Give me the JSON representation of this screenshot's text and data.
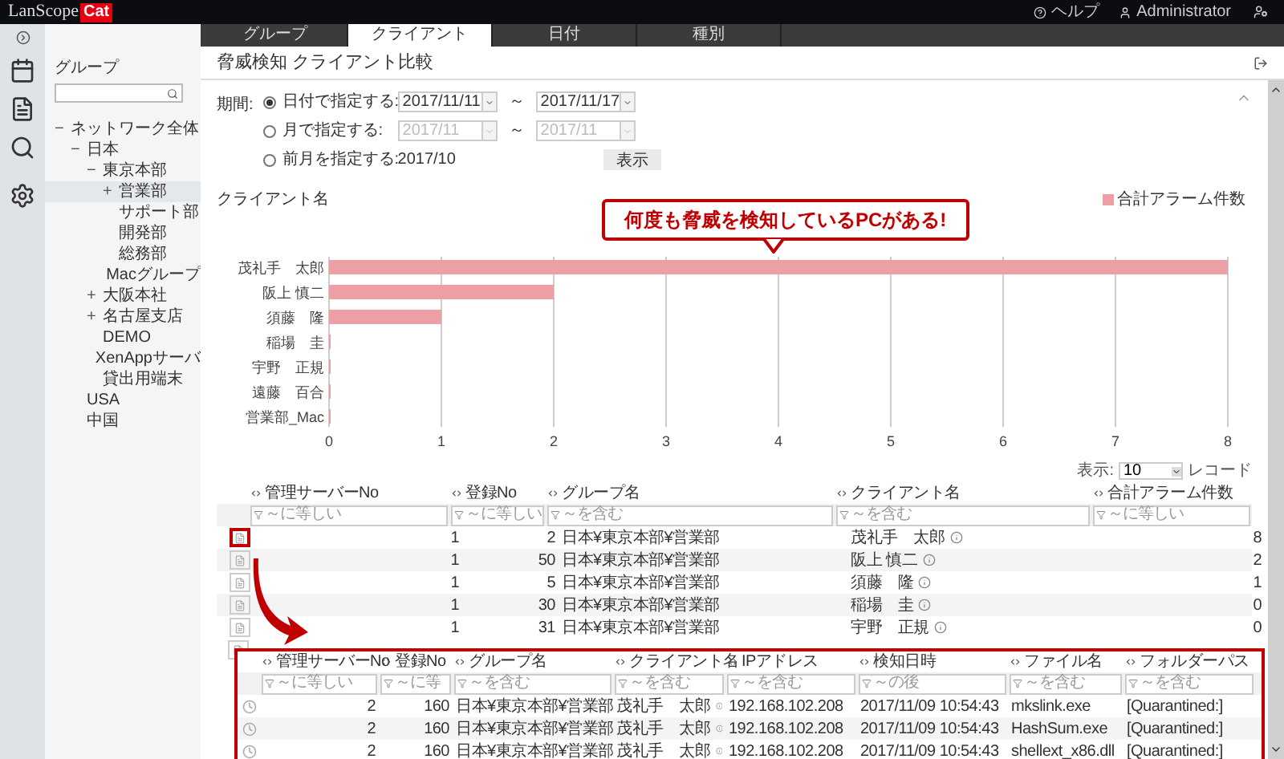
{
  "app": {
    "logo_text": "LanScope",
    "logo_badge": "Cat",
    "help": "ヘルプ",
    "user": "Administrator"
  },
  "tabs": [
    {
      "label": "グループ",
      "selected": false
    },
    {
      "label": "クライアント",
      "selected": true
    },
    {
      "label": "日付",
      "selected": false
    },
    {
      "label": "種別",
      "selected": false
    }
  ],
  "sidebar": {
    "title": "グループ",
    "tree": [
      {
        "label": "ネットワーク全体",
        "toggle": "−",
        "selected": false,
        "children": [
          {
            "label": "日本",
            "toggle": "−",
            "selected": false,
            "children": [
              {
                "label": "東京本部",
                "toggle": "−",
                "selected": false,
                "children": [
                  {
                    "label": "営業部",
                    "toggle": "+",
                    "selected": true
                  },
                  {
                    "label": "サポート部",
                    "selected": false
                  },
                  {
                    "label": "開発部",
                    "selected": false
                  },
                  {
                    "label": "総務部",
                    "selected": false
                  },
                  {
                    "label": "Macグループ",
                    "selected": false
                  }
                ]
              },
              {
                "label": "大阪本社",
                "toggle": "+",
                "selected": false
              },
              {
                "label": "名古屋支店",
                "toggle": "+",
                "selected": false
              },
              {
                "label": "DEMO",
                "selected": false
              },
              {
                "label": "XenAppサーバ",
                "selected": false
              },
              {
                "label": "貸出用端末",
                "selected": false
              }
            ]
          },
          {
            "label": "USA",
            "selected": false
          },
          {
            "label": "中国",
            "selected": false
          }
        ]
      }
    ]
  },
  "page_title": "脅威検知 クライアント比較",
  "period": {
    "label": "期間:",
    "options": [
      {
        "label": "日付で指定する:",
        "selected": true,
        "kind": "range",
        "from": "2017/11/11",
        "to": "2017/11/17",
        "sep": "～",
        "disabled": false
      },
      {
        "label": "月で指定する:",
        "selected": false,
        "kind": "range",
        "from": "2017/11",
        "to": "2017/11",
        "sep": "～",
        "disabled": true
      },
      {
        "label": "前月を指定する:",
        "selected": false,
        "kind": "text",
        "value": "2017/10"
      }
    ],
    "button": "表示"
  },
  "chart_title": "クライアント名",
  "callout": "何度も脅威を検知しているPCがある!",
  "chart_data": {
    "type": "bar",
    "orientation": "horizontal",
    "categories": [
      "茂礼手　太郎",
      "阪上 慎二",
      "須藤　隆",
      "稲場　圭",
      "宇野　正規",
      "遠藤　百合",
      "営業部_Mac"
    ],
    "series": [
      {
        "name": "合計アラーム件数",
        "color": "#eca0a6",
        "values": [
          8,
          2,
          1,
          0,
          0,
          0,
          0
        ]
      }
    ],
    "xticks": [
      0,
      1,
      2,
      3,
      4,
      5,
      6,
      7,
      8
    ],
    "xlim": [
      0,
      8
    ],
    "grid": true
  },
  "table": {
    "page_size_label": "表示:",
    "page_size": "10",
    "page_size_unit": "レコード",
    "columns": [
      {
        "label": "管理サーバーNo",
        "filter": "～に等しい",
        "kind": "number"
      },
      {
        "label": "登録No",
        "filter": "～に等しい",
        "kind": "number"
      },
      {
        "label": "グループ名",
        "filter": "～を含む",
        "kind": "text"
      },
      {
        "label": "クライアント名",
        "filter": "～を含む",
        "kind": "text"
      },
      {
        "label": "合計アラーム件数",
        "filter": "～に等しい",
        "kind": "number"
      }
    ],
    "rows": [
      {
        "highlighted": true,
        "cells": [
          "1",
          "2",
          "日本¥東京本部¥営業部",
          "茂礼手　太郎",
          "8"
        ]
      },
      {
        "highlighted": false,
        "cells": [
          "1",
          "50",
          "日本¥東京本部¥営業部",
          "阪上 慎二",
          "2"
        ]
      },
      {
        "highlighted": false,
        "cells": [
          "1",
          "5",
          "日本¥東京本部¥営業部",
          "須藤　隆",
          "1"
        ]
      },
      {
        "highlighted": false,
        "cells": [
          "1",
          "30",
          "日本¥東京本部¥営業部",
          "稲場　圭",
          "0"
        ]
      },
      {
        "highlighted": false,
        "cells": [
          "1",
          "31",
          "日本¥東京本部¥営業部",
          "宇野　正規",
          "0"
        ]
      }
    ]
  },
  "detail_popup": {
    "columns": [
      {
        "label": "管理サーバーNo",
        "filter": "～に等しい",
        "kind": "number"
      },
      {
        "label": "登録No",
        "filter": "～に等",
        "kind": "number"
      },
      {
        "label": "グループ名",
        "filter": "～を含む",
        "kind": "text"
      },
      {
        "label": "クライアント名",
        "filter": "～を含む",
        "kind": "text"
      },
      {
        "label": "IPアドレス",
        "filter": "～を含む",
        "kind": "text"
      },
      {
        "label": "検知日時",
        "filter": "～の後",
        "kind": "text"
      },
      {
        "label": "ファイル名",
        "filter": "～を含む",
        "kind": "text"
      },
      {
        "label": "フォルダーパス",
        "filter": "～を含む",
        "kind": "text"
      }
    ],
    "rows": [
      [
        "2",
        "160",
        "日本¥東京本部¥営業部",
        "茂礼手　太郎",
        "192.168.102.208",
        "2017/11/09 10:54:43",
        "mkslink.exe",
        "[Quarantined:]"
      ],
      [
        "2",
        "160",
        "日本¥東京本部¥営業部",
        "茂礼手　太郎",
        "192.168.102.208",
        "2017/11/09 10:54:43",
        "HashSum.exe",
        "[Quarantined:]"
      ],
      [
        "2",
        "160",
        "日本¥東京本部¥営業部",
        "茂礼手　太郎",
        "192.168.102.208",
        "2017/11/09 10:54:43",
        "shellext_x86.dll",
        "[Quarantined:]"
      ]
    ]
  }
}
